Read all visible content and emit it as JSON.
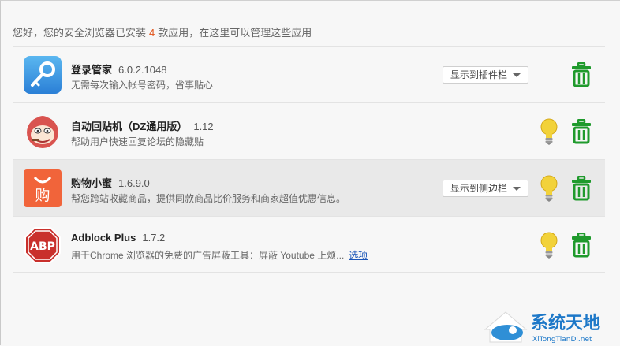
{
  "header": {
    "prefix": "您好，您的安全浏览器已安装",
    "count": "4",
    "suffix": "款应用，在这里可以管理这些应用"
  },
  "apps": [
    {
      "name": "登录管家",
      "version": "6.0.2.1048",
      "desc": "无需每次输入帐号密码，省事贴心",
      "dropdown": "显示到插件栏",
      "icon": "key-icon",
      "has_bulb": false
    },
    {
      "name": "自动回贴机（DZ通用版）",
      "version": "1.12",
      "desc": "帮助用户快速回复论坛的隐藏贴",
      "icon": "monkey-icon",
      "has_bulb": true
    },
    {
      "name": "购物小蜜",
      "version": "1.6.9.0",
      "desc": "帮您跨站收藏商品，提供同款商品比价服务和商家超值优惠信息。",
      "dropdown": "显示到侧边栏",
      "icon": "shopping-bag-icon",
      "has_bulb": true
    },
    {
      "name": "Adblock Plus",
      "version": "1.7.2",
      "desc": "用于Chrome 浏览器的免费的广告屏蔽工具：屏蔽 Youtube 上烦...",
      "link": "选项",
      "icon": "abp-icon",
      "has_bulb": true
    }
  ],
  "icon_text": {
    "shopping": "购",
    "abp": "ABP"
  },
  "watermark": {
    "title": "系统天地",
    "url": "XiTongTianDi.net"
  },
  "colors": {
    "accent": "#e2541b",
    "trash": "#1f9a2c",
    "bulb": "#f2d23a",
    "link": "#1a55b8"
  }
}
